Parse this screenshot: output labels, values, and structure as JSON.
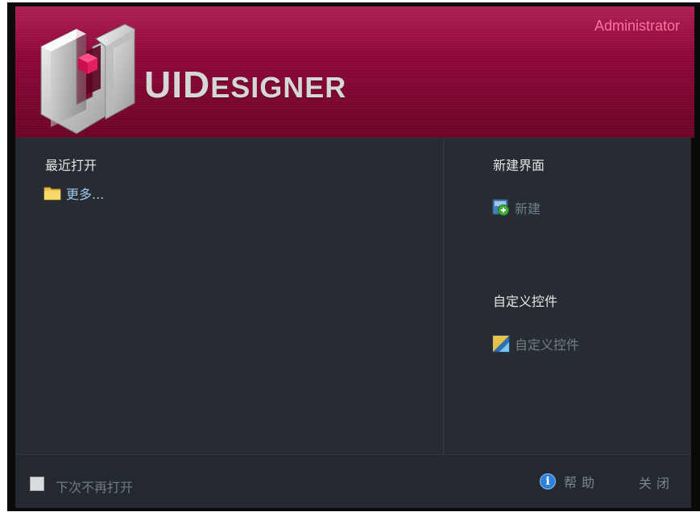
{
  "header": {
    "username": "Administrator",
    "brand_big": "UID",
    "brand_small": "ESIGNER",
    "colors": {
      "banner": "#8a0636",
      "username": "#ff6f9e"
    }
  },
  "recent": {
    "title": "最近打开",
    "more_label": "更多...",
    "more_icon": "folder-icon"
  },
  "new_ui": {
    "title": "新建界面",
    "action_label": "新建",
    "action_icon": "new-document-icon"
  },
  "custom_control": {
    "title": "自定义控件",
    "action_label": "自定义控件",
    "action_icon": "custom-control-icon"
  },
  "footer": {
    "dont_show_label": "下次不再打开",
    "help_label": "帮助",
    "close_label": "关闭",
    "help_icon": "info-icon"
  }
}
